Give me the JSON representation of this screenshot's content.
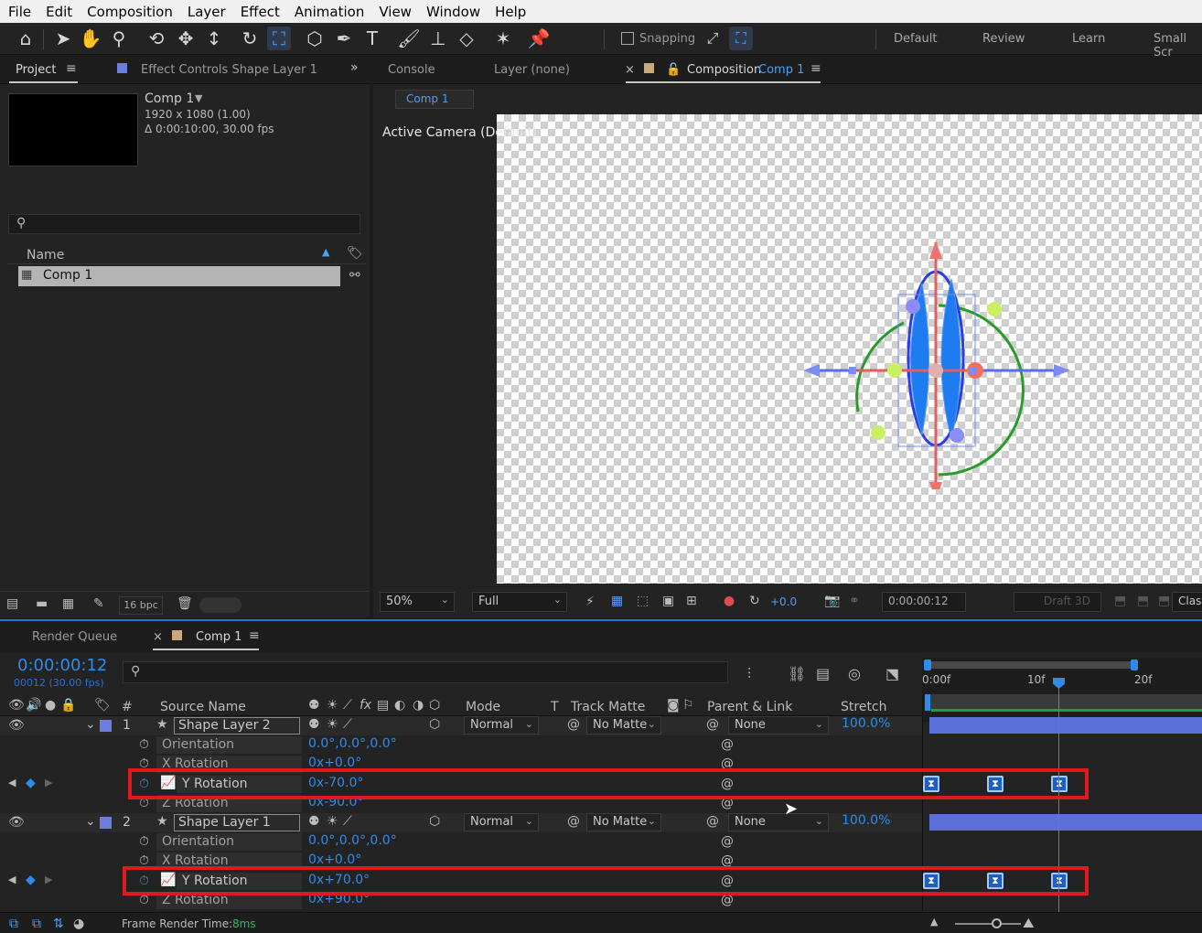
{
  "menu": [
    "File",
    "Edit",
    "Composition",
    "Layer",
    "Effect",
    "Animation",
    "View",
    "Window",
    "Help"
  ],
  "toolbar": {
    "snapping_label": "Snapping",
    "workspaces": [
      "Default",
      "Review",
      "Learn",
      "Small Scr"
    ]
  },
  "project_panel": {
    "tab_project": "Project",
    "tab_effect_controls": "Effect Controls Shape Layer 1",
    "comp_name": "Comp 1",
    "comp_info_1": "1920 x 1080 (1.00)",
    "comp_info_2": "Δ 0:00:10:00, 30.00 fps",
    "search_placeholder": "",
    "name_header": "Name",
    "items": [
      {
        "label": "Comp 1"
      }
    ],
    "bpc": "16 bpc"
  },
  "viewer": {
    "tab_console": "Console",
    "tab_layer": "Layer (none)",
    "tab_composition_prefix": "Composition",
    "tab_composition_name": "Comp 1",
    "breadcrumb": "Comp 1",
    "camera_label": "Active Camera (Default)",
    "zoom": "50%",
    "resolution": "Full",
    "exposure": "+0.0",
    "timecode": "0:00:00:12",
    "draft3d": "Draft 3D",
    "renderer": "Class"
  },
  "timeline": {
    "tab_render_queue": "Render Queue",
    "tab_comp": "Comp 1",
    "current_time": "0:00:00:12",
    "frame_info": "00012 (30.00 fps)",
    "headers": {
      "num": "#",
      "source_name": "Source Name",
      "mode": "Mode",
      "t": "T",
      "track_matte": "Track Matte",
      "parent": "Parent & Link",
      "stretch": "Stretch"
    },
    "ruler": [
      "0:00f",
      "10f",
      "20f"
    ],
    "layers": [
      {
        "num": "1",
        "name": "Shape Layer 2",
        "mode": "Normal",
        "matte": "No Matte",
        "parent": "None",
        "stretch": "100.0%",
        "props": [
          {
            "name": "Orientation",
            "value": "0.0°,0.0°,0.0°"
          },
          {
            "name": "X Rotation",
            "value": "0x+0.0°"
          },
          {
            "name": "Y Rotation",
            "value": "0x-70.0°"
          },
          {
            "name": "Z Rotation",
            "value": "0x-90.0°"
          }
        ]
      },
      {
        "num": "2",
        "name": "Shape Layer 1",
        "mode": "Normal",
        "matte": "No Matte",
        "parent": "None",
        "stretch": "100.0%",
        "props": [
          {
            "name": "Orientation",
            "value": "0.0°,0.0°,0.0°"
          },
          {
            "name": "X Rotation",
            "value": "0x+0.0°"
          },
          {
            "name": "Y Rotation",
            "value": "0x+70.0°"
          },
          {
            "name": "Z Rotation",
            "value": "0x+90.0°"
          }
        ]
      }
    ],
    "footer_label": "Frame Render Time:",
    "footer_value": "8ms"
  },
  "colors": {
    "accent": "#2d8ceb",
    "highlight_box": "#e0181f",
    "shape_fill": "#1e7bf0",
    "layer_bar": "#5d6fd8"
  }
}
